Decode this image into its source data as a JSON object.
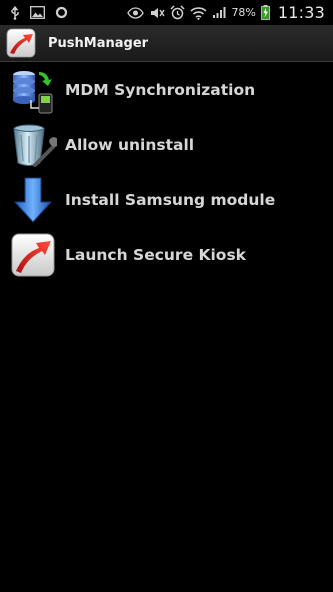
{
  "status_bar": {
    "icons_left": [
      "usb-icon",
      "image-icon",
      "sync-icon"
    ],
    "icons_right": [
      "eye-icon",
      "mute-icon",
      "alarm-icon",
      "wifi-icon",
      "signal-icon"
    ],
    "battery_percent": "78%",
    "time": "11:33"
  },
  "app": {
    "title": "PushManager",
    "icon": "arrow-launch-icon"
  },
  "menu": {
    "items": [
      {
        "label": "MDM Synchronization",
        "icon": "database-sync-icon"
      },
      {
        "label": "Allow uninstall",
        "icon": "trash-icon"
      },
      {
        "label": "Install Samsung module",
        "icon": "download-arrow-icon"
      },
      {
        "label": "Launch Secure Kiosk",
        "icon": "launch-icon"
      }
    ]
  },
  "colors": {
    "background": "#000000",
    "titlebar": "#222222",
    "item_text": "#d6d6d6",
    "accent_red": "#d42222"
  }
}
